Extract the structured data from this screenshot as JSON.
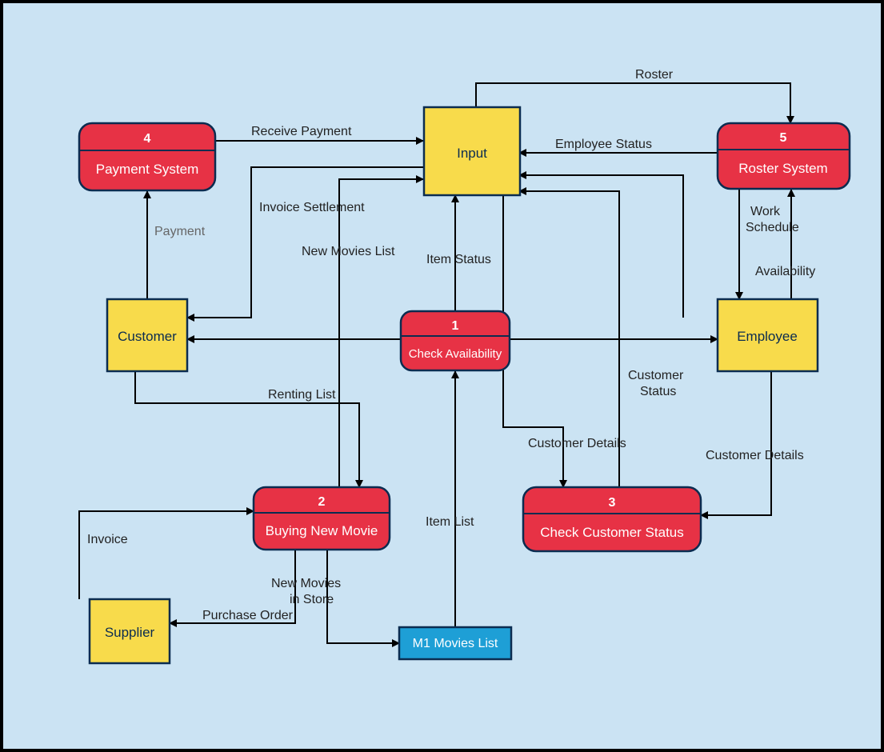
{
  "processes": {
    "p1": {
      "num": "1",
      "label": "Check Availability"
    },
    "p2": {
      "num": "2",
      "label": "Buying New Movie"
    },
    "p3": {
      "num": "3",
      "label": "Check Customer Status"
    },
    "p4": {
      "num": "4",
      "label": "Payment System"
    },
    "p5": {
      "num": "5",
      "label": "Roster System"
    }
  },
  "entities": {
    "input": "Input",
    "customer": "Customer",
    "employee": "Employee",
    "supplier": "Supplier"
  },
  "stores": {
    "m1": "M1 Movies List"
  },
  "flows": {
    "roster": "Roster",
    "receive_payment": "Receive Payment",
    "employee_status": "Employee Status",
    "payment": "Payment",
    "invoice_settlement": "Invoice Settlement",
    "new_movies_list": "New Movies List",
    "item_status": "Item Status",
    "work_schedule1": "Work",
    "work_schedule2": "Schedule",
    "availability": "Availability",
    "renting_list": "Renting List",
    "customer_status1": "Customer",
    "customer_status2": "Status",
    "customer_details": "Customer Details",
    "customer_details2": "Customer Details",
    "item_list": "Item List",
    "invoice": "Invoice",
    "new_movies_store1": "New Movies",
    "new_movies_store2": "in Store",
    "purchase_order": "Purchase Order"
  }
}
